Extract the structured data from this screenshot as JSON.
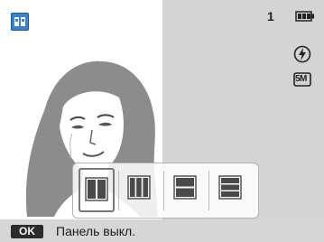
{
  "status": {
    "mode_icon": "guide-mode-icon",
    "frame_count": "1",
    "battery_icon": "battery-full-icon",
    "flash_icon": "flash-off-icon",
    "size_badge": "5M"
  },
  "viewfinder": {
    "subject_icon": "woman-portrait-illustration"
  },
  "panel": {
    "options": [
      {
        "icon": "split-2-vertical-icon",
        "selected": true
      },
      {
        "icon": "split-3-vertical-icon",
        "selected": false
      },
      {
        "icon": "split-2-horizontal-icon",
        "selected": false
      },
      {
        "icon": "split-3-horizontal-icon",
        "selected": false
      }
    ]
  },
  "bottom_bar": {
    "ok_key": "OK",
    "hint": "Панель выкл."
  },
  "colors": {
    "accent_blue": "#3a83c8",
    "right_pane": "#d4d4d4",
    "bar": "#d6d6d6"
  }
}
